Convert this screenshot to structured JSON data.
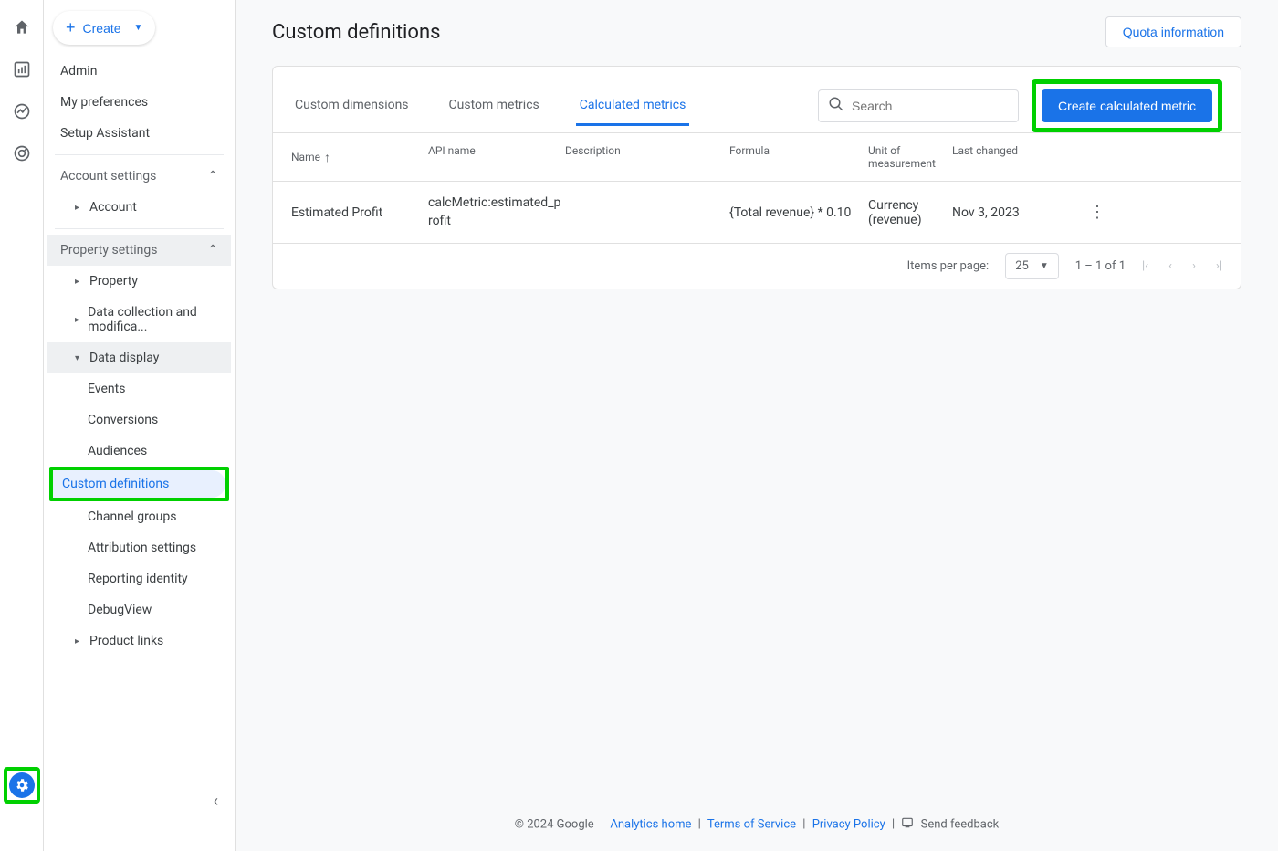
{
  "create_button": "Create",
  "sidebar": {
    "admin": "Admin",
    "my_preferences": "My preferences",
    "setup_assistant": "Setup Assistant",
    "account_settings": "Account settings",
    "account": "Account",
    "property_settings": "Property settings",
    "property": "Property",
    "data_collection": "Data collection and modifica...",
    "data_display": "Data display",
    "events": "Events",
    "conversions": "Conversions",
    "audiences": "Audiences",
    "custom_definitions": "Custom definitions",
    "channel_groups": "Channel groups",
    "attribution_settings": "Attribution settings",
    "reporting_identity": "Reporting identity",
    "debugview": "DebugView",
    "product_links": "Product links"
  },
  "page": {
    "title": "Custom definitions",
    "quota_btn": "Quota information",
    "tabs": {
      "dimensions": "Custom dimensions",
      "metrics": "Custom metrics",
      "calculated": "Calculated metrics"
    },
    "search_placeholder": "Search",
    "create_metric_btn": "Create calculated metric",
    "columns": {
      "name": "Name",
      "api": "API name",
      "desc": "Description",
      "formula": "Formula",
      "unit": "Unit of measurement",
      "changed": "Last changed"
    },
    "rows": [
      {
        "name": "Estimated Profit",
        "api": "calcMetric:estimated_profit",
        "desc": "",
        "formula": "{Total revenue} * 0.10",
        "unit": "Currency (revenue)",
        "changed": "Nov 3, 2023"
      }
    ],
    "pagination": {
      "items_per_page_label": "Items per page:",
      "page_size": "25",
      "range": "1 – 1 of 1"
    }
  },
  "footer": {
    "copyright": "© 2024 Google",
    "analytics_home": "Analytics home",
    "terms": "Terms of Service",
    "privacy": "Privacy Policy",
    "feedback": "Send feedback"
  }
}
